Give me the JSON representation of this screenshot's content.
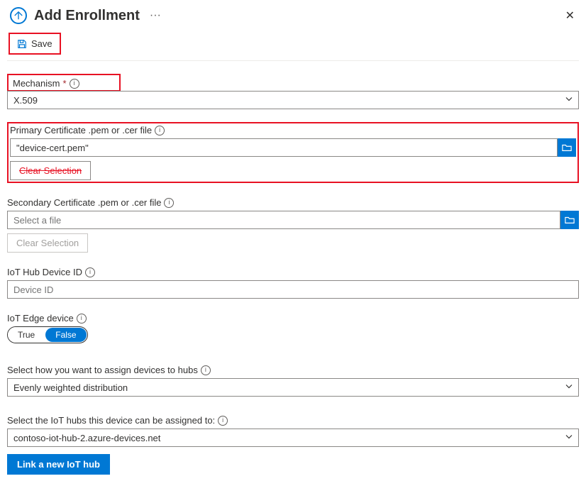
{
  "header": {
    "title": "Add Enrollment",
    "more": "···",
    "close": "✕"
  },
  "toolbar": {
    "save_label": "Save"
  },
  "mechanism": {
    "label": "Mechanism",
    "value": "X.509"
  },
  "primary_cert": {
    "label": "Primary Certificate .pem or .cer file",
    "value": "\"device-cert.pem\"",
    "clear_label": "Clear Selection"
  },
  "secondary_cert": {
    "label": "Secondary Certificate .pem or .cer file",
    "placeholder": "Select a file",
    "clear_label": "Clear Selection"
  },
  "device_id": {
    "label": "IoT Hub Device ID",
    "placeholder": "Device ID"
  },
  "edge": {
    "label": "IoT Edge device",
    "true_label": "True",
    "false_label": "False"
  },
  "assign": {
    "label": "Select how you want to assign devices to hubs",
    "value": "Evenly weighted distribution"
  },
  "hubs": {
    "label": "Select the IoT hubs this device can be assigned to:",
    "value": "contoso-iot-hub-2.azure-devices.net",
    "link_label": "Link a new IoT hub"
  }
}
